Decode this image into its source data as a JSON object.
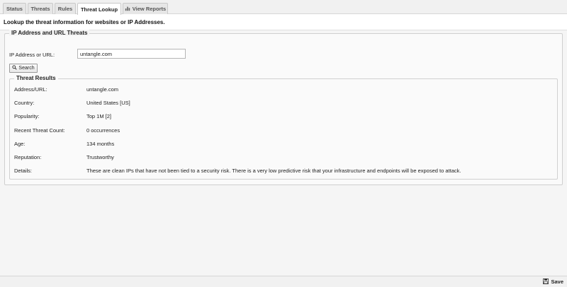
{
  "tabs": [
    {
      "label": "Status"
    },
    {
      "label": "Threats"
    },
    {
      "label": "Rules"
    },
    {
      "label": "Threat Lookup"
    },
    {
      "label": "View Reports"
    }
  ],
  "header": {
    "text": "Lookup the threat information for websites or IP Addresses."
  },
  "lookup": {
    "legend": "IP Address and URL Threats",
    "field_label": "IP Address or URL:",
    "field_value": "untangle.com",
    "search_label": "Search"
  },
  "results": {
    "legend": "Threat Results",
    "rows": [
      {
        "key": "Address/URL:",
        "value": "untangle.com"
      },
      {
        "key": "Country:",
        "value": "United States [US]"
      },
      {
        "key": "Popularity:",
        "value": "Top 1M [2]"
      },
      {
        "key": "Recent Threat Count:",
        "value": "0 occurrences"
      },
      {
        "key": "Age:",
        "value": "134 months"
      },
      {
        "key": "Reputation:",
        "value": "Trustworthy"
      },
      {
        "key": "Details:",
        "value": "These are clean IPs that have not been tied to a security risk. There is a very low predictive risk that your infrastructure and endpoints will be exposed to attack."
      }
    ]
  },
  "footer": {
    "save_label": "Save"
  },
  "icons": {
    "view_reports": "chart-icon",
    "search": "search-icon",
    "save": "save-icon"
  }
}
